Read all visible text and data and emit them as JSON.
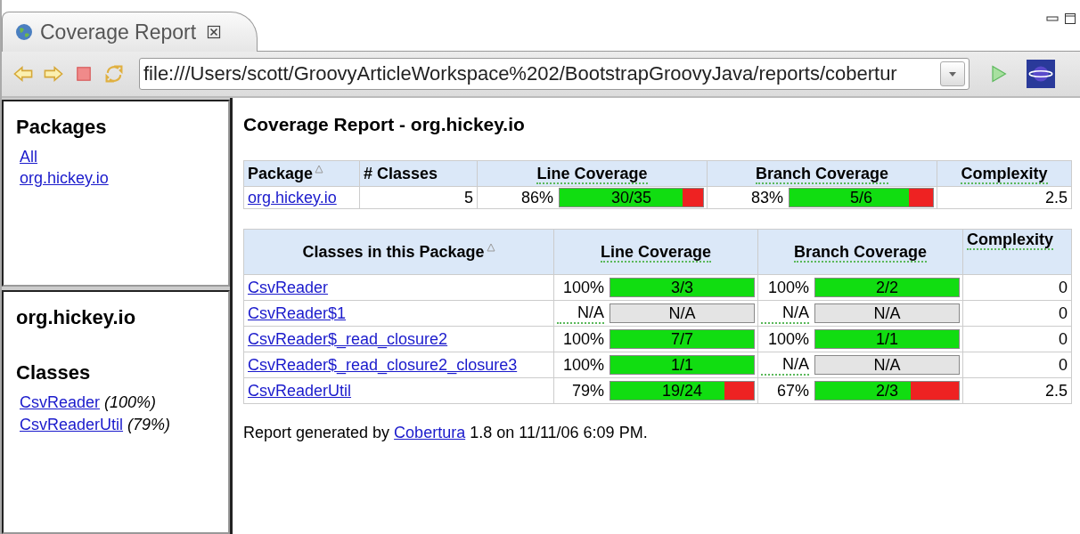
{
  "tab": {
    "title": "Coverage Report"
  },
  "toolbar": {
    "url": "file:///Users/scott/GroovyArticleWorkspace%202/BootstrapGroovyJava/reports/cobertur"
  },
  "packages_panel": {
    "title": "Packages",
    "links": [
      "All",
      "org.hickey.io"
    ]
  },
  "classes_panel": {
    "package": "org.hickey.io",
    "title": "Classes",
    "items": [
      {
        "name": "CsvReader",
        "percent": "(100%)"
      },
      {
        "name": "CsvReaderUtil",
        "percent": "(79%)"
      }
    ]
  },
  "report": {
    "title": "Coverage Report - org.hickey.io",
    "package_table": {
      "columns": [
        "Package",
        "# Classes",
        "Line Coverage",
        "Branch Coverage",
        "Complexity"
      ],
      "rows": [
        {
          "name": "org.hickey.io",
          "classes": "5",
          "line": {
            "percent": "86%",
            "label": "30/35",
            "level": 0.857
          },
          "branch": {
            "percent": "83%",
            "label": "5/6",
            "level": 0.833
          },
          "complexity": "2.5"
        }
      ]
    },
    "class_table": {
      "columns": [
        "Classes in this Package",
        "Line Coverage",
        "Branch Coverage",
        "Complexity"
      ],
      "rows": [
        {
          "name": "CsvReader",
          "line": {
            "percent": "100%",
            "label": "3/3",
            "level": 1
          },
          "branch": {
            "percent": "100%",
            "label": "2/2",
            "level": 1
          },
          "complexity": "0"
        },
        {
          "name": "CsvReader$1",
          "line": {
            "percent": "N/A",
            "label": "N/A"
          },
          "branch": {
            "percent": "N/A",
            "label": "N/A"
          },
          "complexity": "0"
        },
        {
          "name": "CsvReader$_read_closure2",
          "line": {
            "percent": "100%",
            "label": "7/7",
            "level": 1
          },
          "branch": {
            "percent": "100%",
            "label": "1/1",
            "level": 1
          },
          "complexity": "0"
        },
        {
          "name": "CsvReader$_read_closure2_closure3",
          "line": {
            "percent": "100%",
            "label": "1/1",
            "level": 1
          },
          "branch": {
            "percent": "N/A",
            "label": "N/A"
          },
          "complexity": "0"
        },
        {
          "name": "CsvReaderUtil",
          "line": {
            "percent": "79%",
            "label": "19/24",
            "level": 0.792
          },
          "branch": {
            "percent": "67%",
            "label": "2/3",
            "level": 0.667
          },
          "complexity": "2.5"
        }
      ]
    },
    "footer": {
      "before": "Report generated by",
      "link": "Cobertura",
      "after": "1.8 on 11/11/06 6:09 PM."
    }
  }
}
